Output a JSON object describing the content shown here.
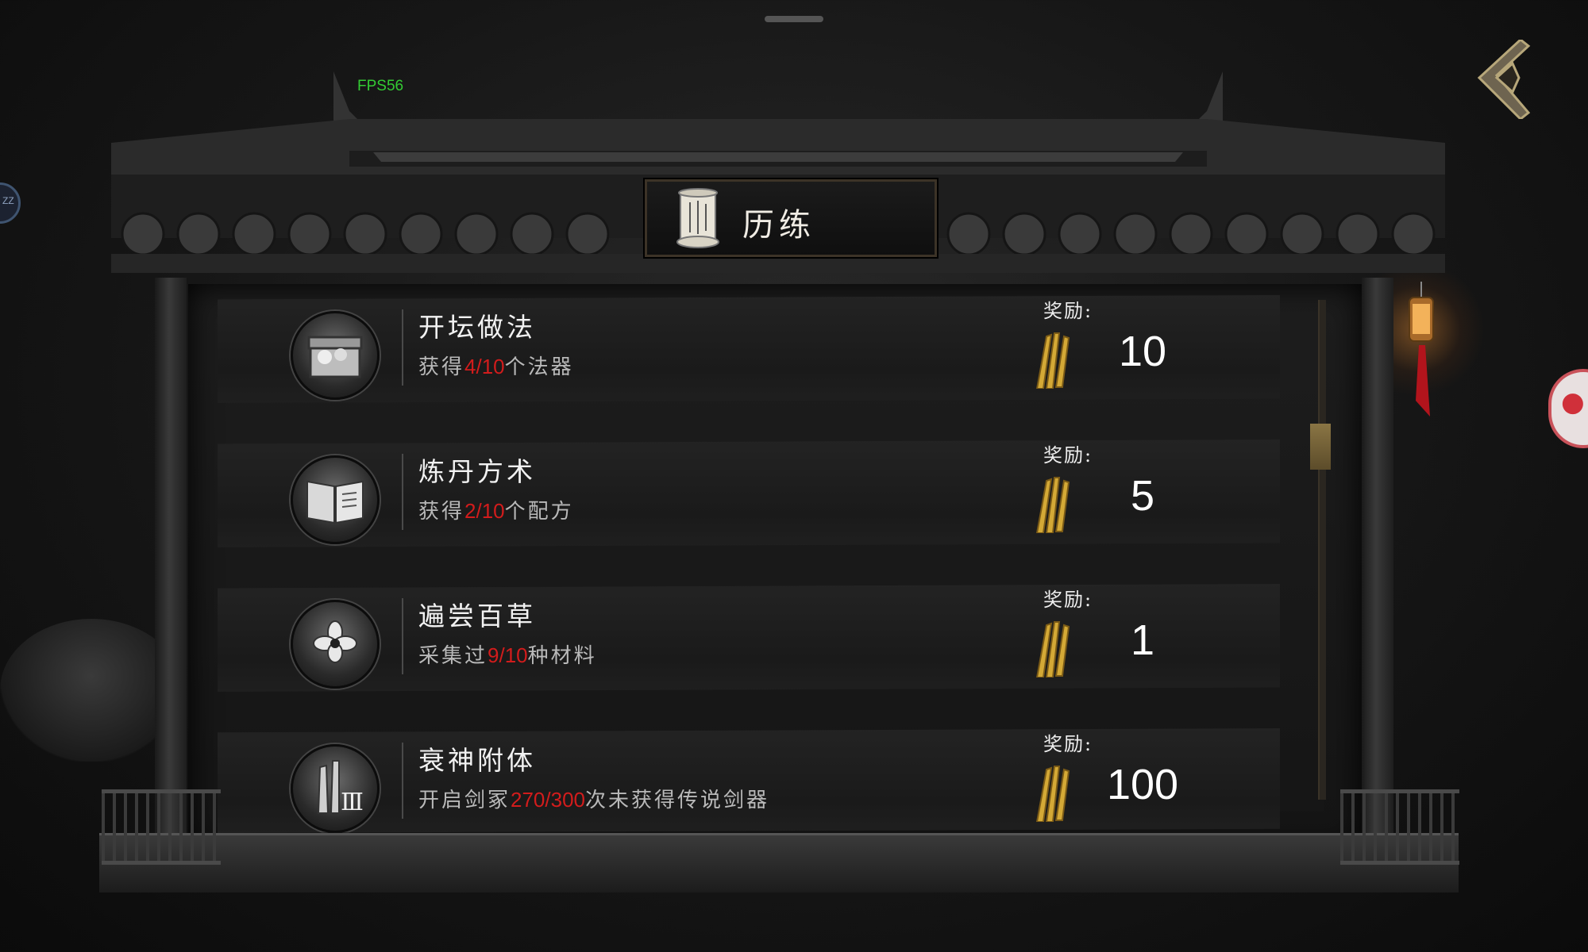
{
  "system": {
    "fps_label": "FPS56",
    "edge_badge_text": "ZZ"
  },
  "title": {
    "text": "历练"
  },
  "rows": [
    {
      "title": "开坛做法",
      "desc_prefix": "获得",
      "progress": "4/10",
      "desc_suffix": "个法器",
      "reward_label": "奖励:",
      "reward_value": "10",
      "icon": "treasure-chest-icon"
    },
    {
      "title": "炼丹方术",
      "desc_prefix": "获得",
      "progress": "2/10",
      "desc_suffix": "个配方",
      "reward_label": "奖励:",
      "reward_value": "5",
      "icon": "open-book-icon"
    },
    {
      "title": "遍尝百草",
      "desc_prefix": "采集过",
      "progress": "9/10",
      "desc_suffix": "种材料",
      "reward_label": "奖励:",
      "reward_value": "1",
      "icon": "flower-icon"
    },
    {
      "title": "衰神附体",
      "desc_prefix": "开启剑冢",
      "progress": "270/300",
      "desc_suffix": "次未获得传说剑器",
      "reward_label": "奖励:",
      "reward_value": "100",
      "icon": "sword-tomb-icon",
      "icon_badge": "Ⅲ"
    }
  ],
  "colors": {
    "progress": "#d21c1c",
    "accent_gold": "#c9a23a",
    "fps_green": "#33cc33"
  },
  "scrollbar": {
    "position_fraction": 0.25
  }
}
